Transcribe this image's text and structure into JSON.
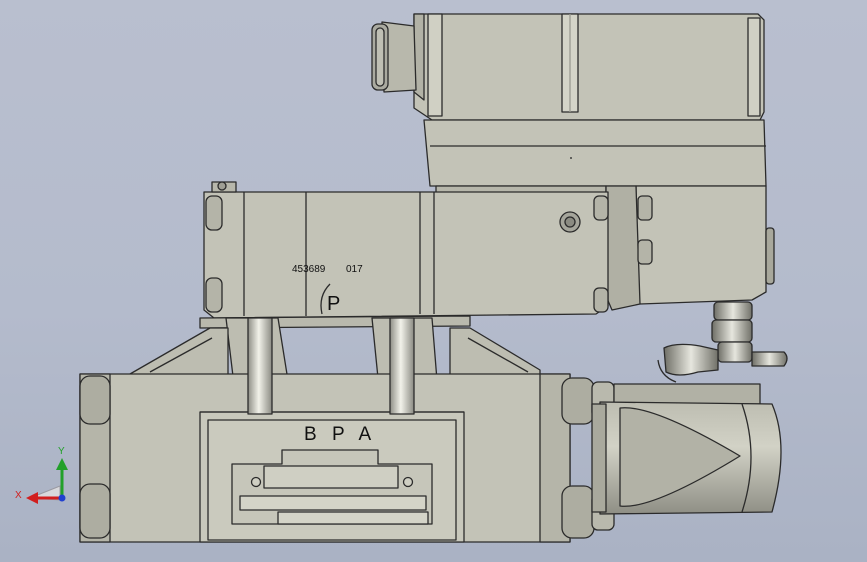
{
  "drawing": {
    "serial_number": "453689",
    "revision": "017",
    "port_mark": "P",
    "port_labels": "B P A"
  },
  "triad": {
    "x_label": "X",
    "y_label": "Y",
    "x_color": "#d11e1e",
    "y_color": "#22a02a",
    "z_color": "#2040d0"
  },
  "colors": {
    "background": "#b6bdce",
    "body": "#c3c3b7",
    "body_dark": "#a9a99d",
    "outline": "#2b2b2b"
  }
}
